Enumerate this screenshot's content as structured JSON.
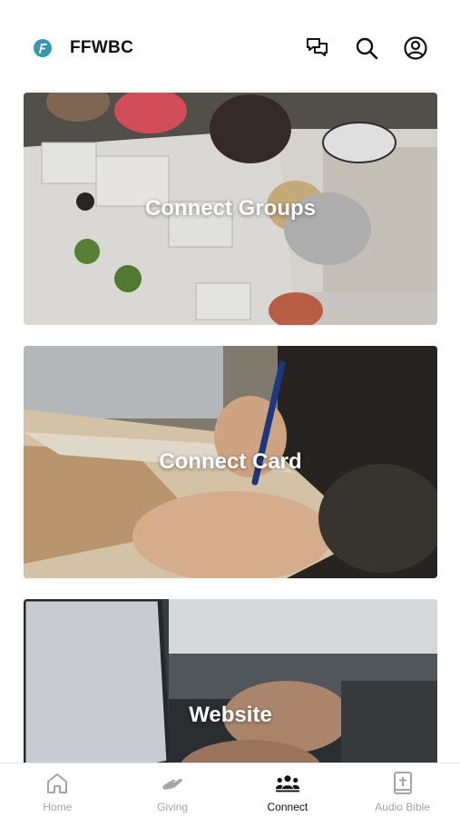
{
  "app": {
    "title": "FFWBC",
    "logo_letter": "F",
    "accent": "#3a97b0"
  },
  "header": {
    "actions": [
      {
        "icon": "chat-icon"
      },
      {
        "icon": "search-icon"
      },
      {
        "icon": "account-icon"
      }
    ]
  },
  "cards": [
    {
      "label": "Connect Groups",
      "image": "people-group-table-photo"
    },
    {
      "label": "Connect Card",
      "image": "writing-in-book-photo"
    },
    {
      "label": "Website",
      "image": "laptop-typing-photo"
    }
  ],
  "tabs": [
    {
      "label": "Home",
      "icon": "home-icon",
      "active": false
    },
    {
      "label": "Giving",
      "icon": "giving-hand-icon",
      "active": false
    },
    {
      "label": "Connect",
      "icon": "people-icon",
      "active": true
    },
    {
      "label": "Audio Bible",
      "icon": "bible-icon",
      "active": false
    }
  ],
  "colors": {
    "active_tab": "#111111",
    "inactive_tab": "#a5a5a5",
    "divider": "#e2e2e2"
  }
}
